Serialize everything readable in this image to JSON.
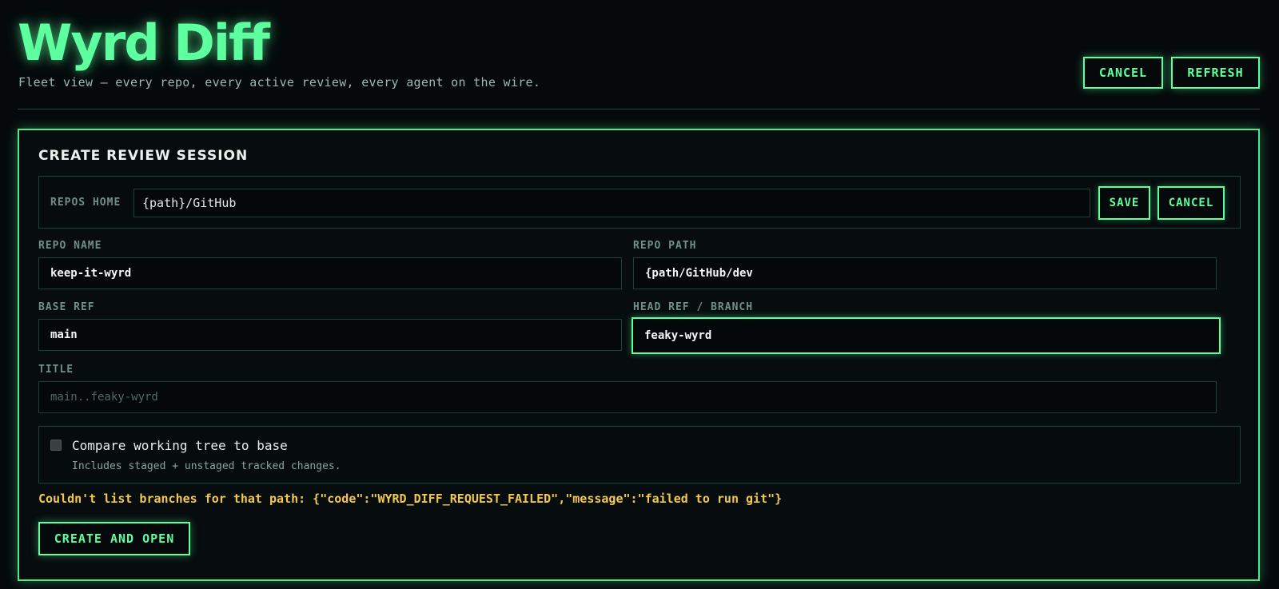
{
  "header": {
    "title": "Wyrd Diff",
    "subtitle": "Fleet view — every repo, every active review, every agent on the wire.",
    "cancel_label": "CANCEL",
    "refresh_label": "REFRESH"
  },
  "form": {
    "title": "CREATE REVIEW SESSION",
    "repos_home": {
      "label": "REPOS HOME",
      "value": "{path}/GitHub",
      "save_label": "SAVE",
      "cancel_label": "CANCEL"
    },
    "repo_name": {
      "label": "REPO NAME",
      "value": "keep-it-wyrd"
    },
    "repo_path": {
      "label": "REPO PATH",
      "value": "{path/GitHub/dev"
    },
    "base_ref": {
      "label": "BASE REF",
      "value": "main"
    },
    "head_ref": {
      "label": "HEAD REF / BRANCH",
      "value": "feaky-wyrd"
    },
    "title_field": {
      "label": "TITLE",
      "value": "",
      "placeholder": "main..feaky-wyrd"
    },
    "compare": {
      "label": "Compare working tree to base",
      "hint": "Includes staged + unstaged tracked changes.",
      "checked": false
    },
    "error": "Couldn't list branches for that path: {\"code\":\"WYRD_DIFF_REQUEST_FAILED\",\"message\":\"failed to run git\"}",
    "submit_label": "CREATE AND OPEN"
  },
  "colors": {
    "accent": "#5dff9e",
    "background": "#05090b",
    "error": "#f2c94c",
    "border": "#22403a"
  }
}
